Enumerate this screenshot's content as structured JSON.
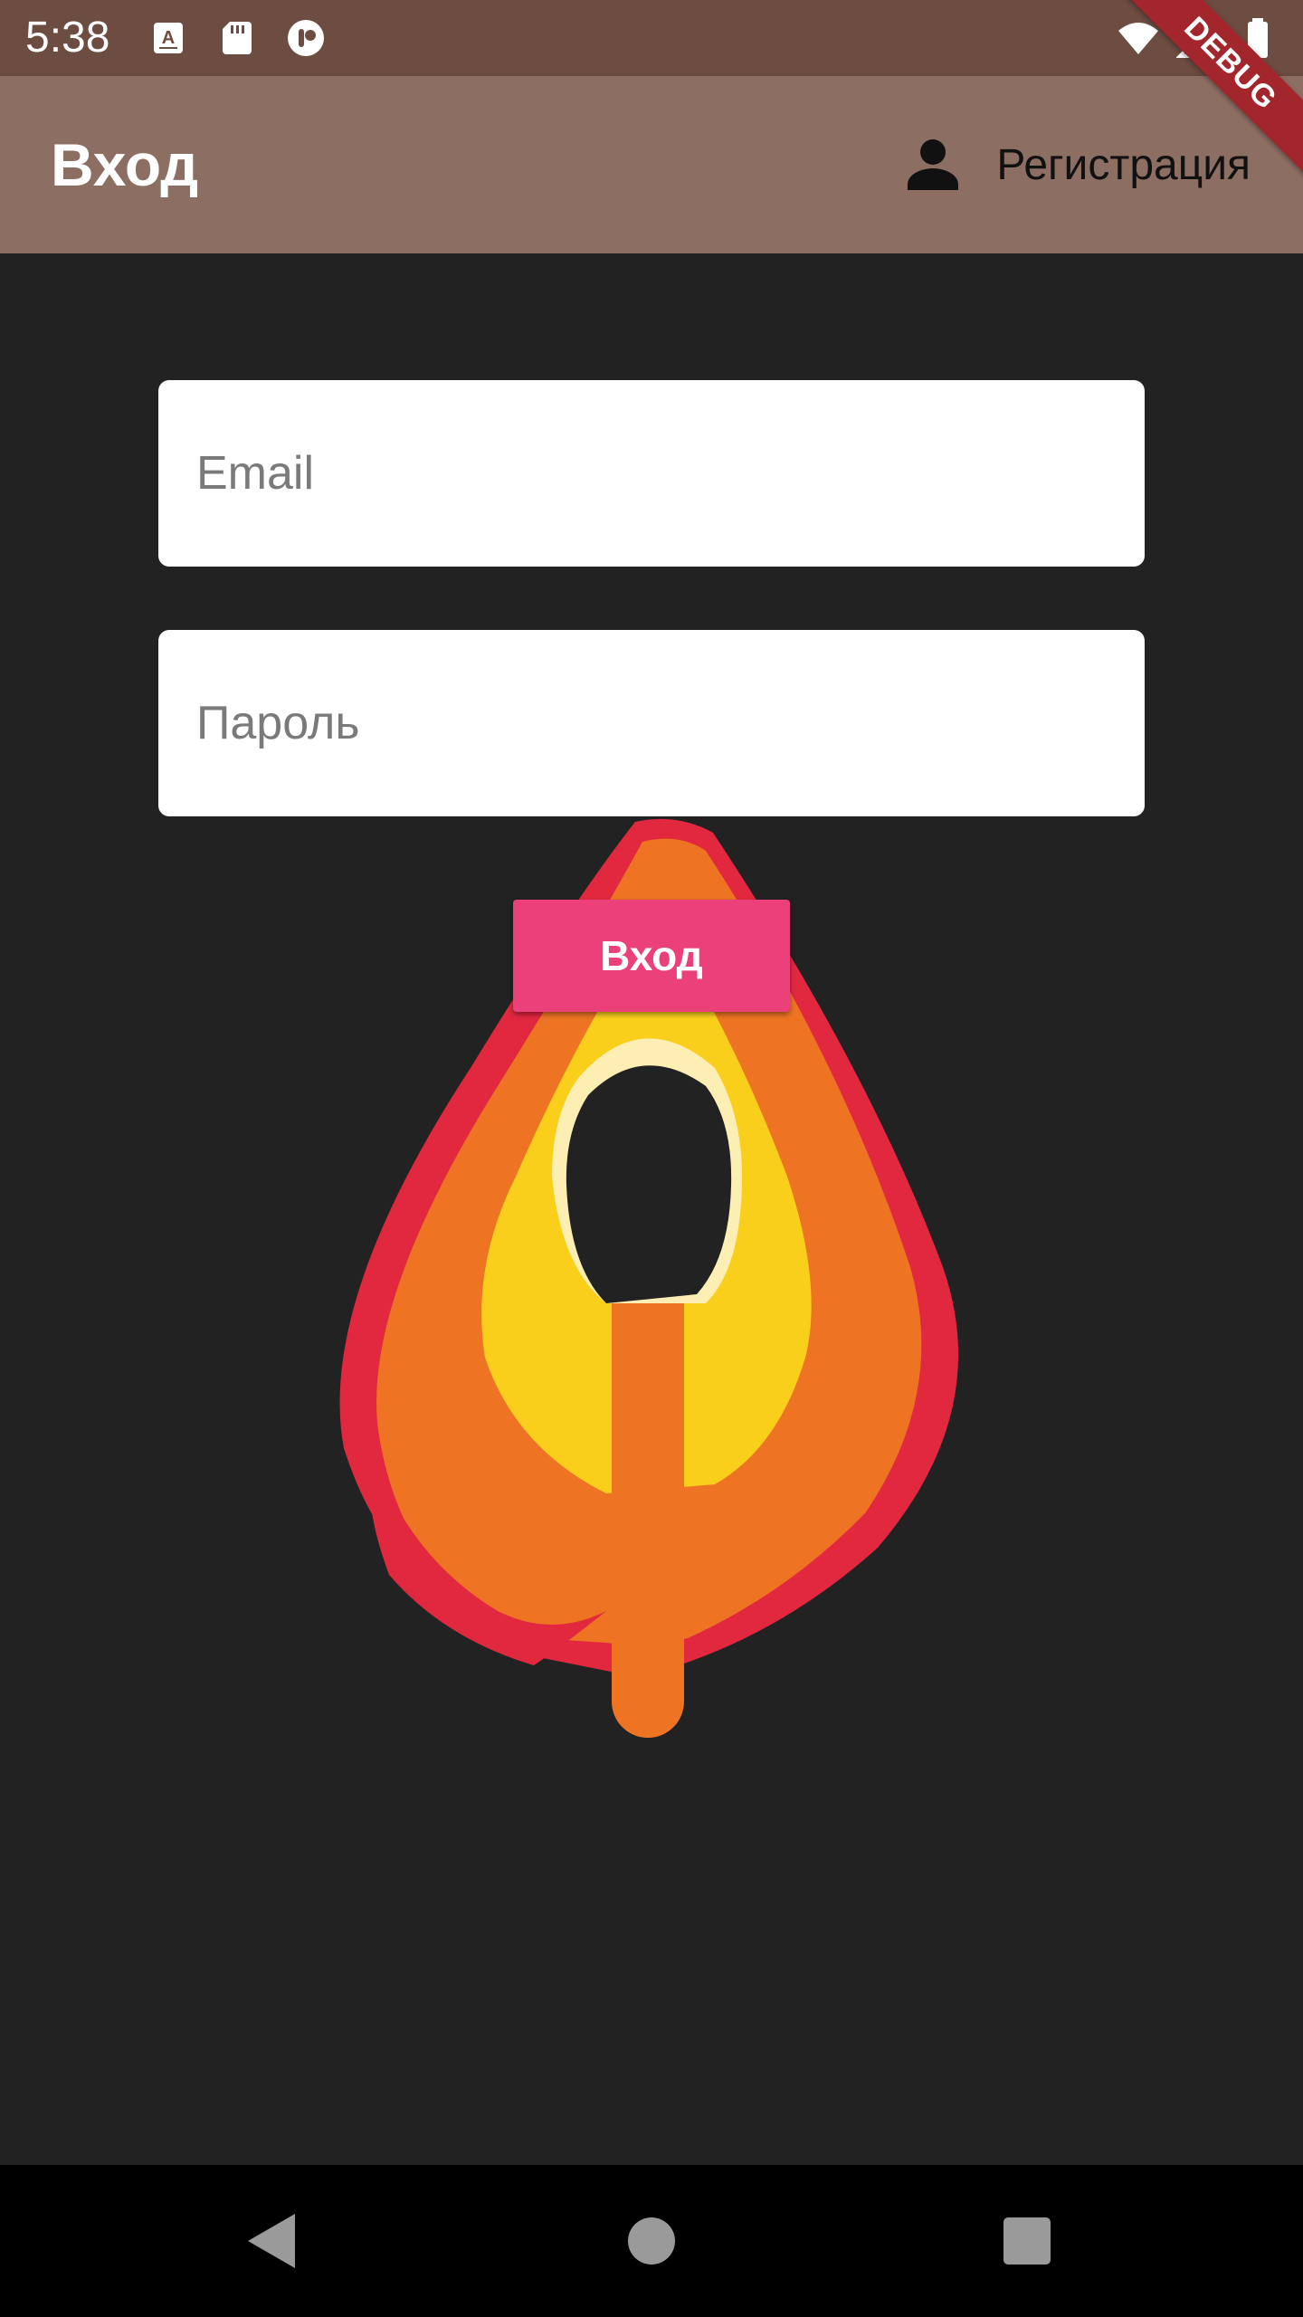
{
  "status_bar": {
    "time": "5:38",
    "left_icons": [
      "a-keyboard-icon",
      "sd-card-icon",
      "app-notification-icon"
    ],
    "right_icons": [
      "wifi-icon",
      "cell-signal-icon",
      "battery-icon"
    ]
  },
  "debug_banner": "DEBUG",
  "app_bar": {
    "title": "Вход",
    "register_label": "Регистрация",
    "background": "#8d6e63"
  },
  "form": {
    "email_placeholder": "Email",
    "password_placeholder": "Пароль",
    "login_label": "Вход",
    "login_color": "#ec407a"
  },
  "colors": {
    "status_bar": "#6d4c41",
    "background": "#222222",
    "flame_red": "#e2283f",
    "flame_orange": "#ee7424",
    "flame_yellow": "#f9cf1c"
  },
  "nav_bar": {
    "buttons": [
      "back-icon",
      "home-icon",
      "recents-icon"
    ]
  }
}
